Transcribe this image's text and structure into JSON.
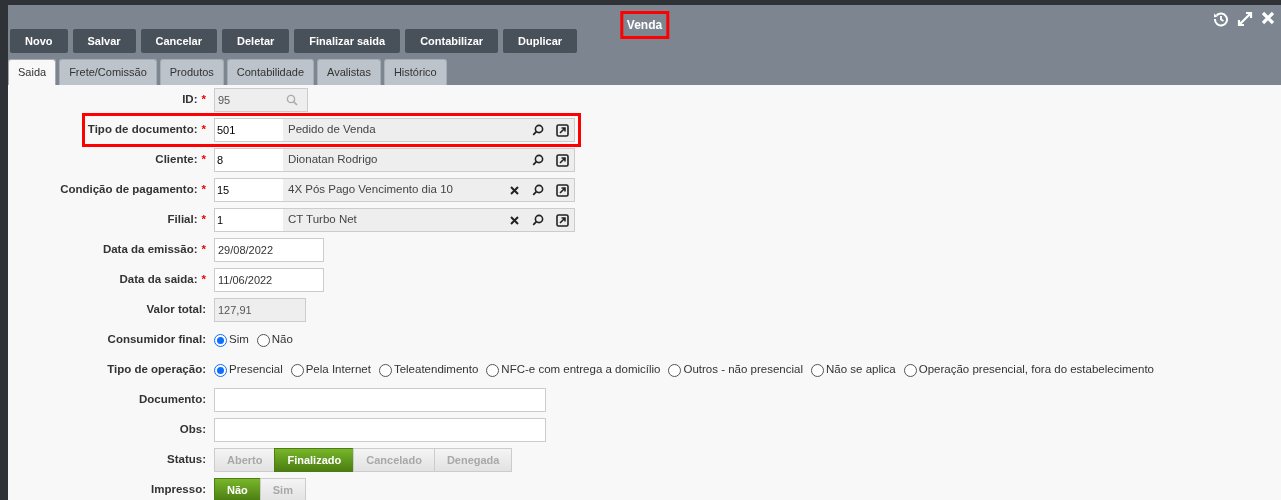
{
  "window": {
    "title": "Venda",
    "title_highlighted": true
  },
  "toolbar": {
    "buttons": [
      "Novo",
      "Salvar",
      "Cancelar",
      "Deletar",
      "Finalizar saida",
      "Contabilizar",
      "Duplicar"
    ]
  },
  "tabs": [
    {
      "label": "Saida",
      "selected": true
    },
    {
      "label": "Frete/Comissão",
      "selected": false
    },
    {
      "label": "Produtos",
      "selected": false
    },
    {
      "label": "Contabilidade",
      "selected": false
    },
    {
      "label": "Avalistas",
      "selected": false
    },
    {
      "label": "Histórico",
      "selected": false
    }
  ],
  "form": {
    "fields": [
      {
        "kind": "id",
        "label": "ID:",
        "required_mark": "*",
        "value": "95"
      },
      {
        "kind": "lookup",
        "label": "Tipo de documento:",
        "required_mark": "*",
        "code": "501",
        "description": "Pedido de Venda",
        "clearable": false,
        "highlighted": true
      },
      {
        "kind": "lookup",
        "label": "Cliente:",
        "required_mark": "*",
        "code": "8",
        "description": "Dionatan Rodrigo",
        "clearable": false,
        "highlighted": false
      },
      {
        "kind": "lookup",
        "label": "Condição de pagamento:",
        "required_mark": "*",
        "code": "15",
        "description": "4X Pós Pago Vencimento dia 10",
        "clearable": true,
        "highlighted": false
      },
      {
        "kind": "lookup",
        "label": "Filial:",
        "required_mark": "*",
        "code": "1",
        "description": "CT Turbo Net",
        "clearable": true,
        "highlighted": false
      },
      {
        "kind": "date",
        "label": "Data da emissão:",
        "required_mark": "*",
        "value": "29/08/2022"
      },
      {
        "kind": "date",
        "label": "Data da saida:",
        "required_mark": "*",
        "value": "11/06/2022"
      },
      {
        "kind": "readonly",
        "label": "Valor total:",
        "value": "127,91"
      },
      {
        "kind": "radio",
        "label": "Consumidor final:",
        "options": [
          {
            "label": "Sim",
            "selected": true
          },
          {
            "label": "Não",
            "selected": false
          }
        ]
      },
      {
        "kind": "radio",
        "label": "Tipo de operação:",
        "options": [
          {
            "label": "Presencial",
            "selected": true
          },
          {
            "label": "Pela Internet",
            "selected": false
          },
          {
            "label": "Teleatendimento",
            "selected": false
          },
          {
            "label": "NFC-e com entrega a domicílio",
            "selected": false
          },
          {
            "label": "Outros - não presencial",
            "selected": false
          },
          {
            "label": "Não se aplica",
            "selected": false
          },
          {
            "label": "Operação presencial, fora do estabelecimento",
            "selected": false
          }
        ]
      },
      {
        "kind": "text",
        "label": "Documento:"
      },
      {
        "kind": "text",
        "label": "Obs:"
      },
      {
        "kind": "segmented",
        "label": "Status:",
        "options": [
          {
            "label": "Aberto",
            "selected": false
          },
          {
            "label": "Finalizado",
            "selected": true
          },
          {
            "label": "Cancelado",
            "selected": false
          },
          {
            "label": "Denegada",
            "selected": false
          }
        ]
      },
      {
        "kind": "segmented",
        "label": "Impresso:",
        "options": [
          {
            "label": "Não",
            "selected": true
          },
          {
            "label": "Sim",
            "selected": false
          }
        ]
      }
    ]
  }
}
